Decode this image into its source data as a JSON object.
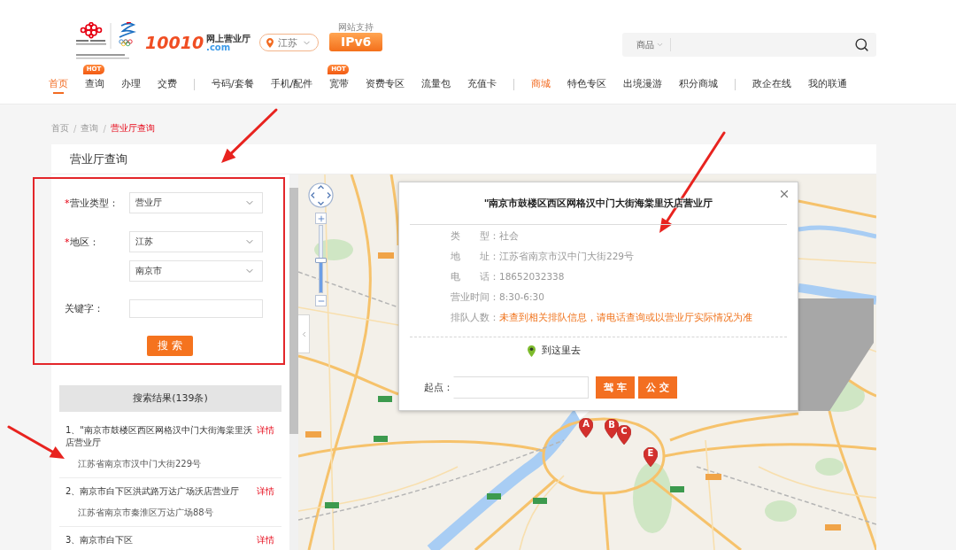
{
  "header": {
    "logo": {
      "number": "10010",
      "tagline": "网上营业厅",
      "domain": ".com"
    },
    "location": {
      "label": "江苏"
    },
    "ipv6": {
      "caption": "网站支持",
      "badge": "IPv6"
    },
    "search": {
      "category": "商品"
    }
  },
  "nav": [
    {
      "items": [
        {
          "label": "首页",
          "selected": true,
          "highlighted": false
        },
        {
          "label": "查询",
          "selected": false,
          "highlighted": false,
          "badge": "HOT"
        },
        {
          "label": "办理",
          "selected": false,
          "highlighted": false
        },
        {
          "label": "交费",
          "selected": false,
          "highlighted": false
        }
      ]
    },
    {
      "items": [
        {
          "label": "号码/套餐",
          "selected": false,
          "highlighted": false
        },
        {
          "label": "手机/配件",
          "selected": false,
          "highlighted": false
        },
        {
          "label": "宽带",
          "selected": false,
          "highlighted": false,
          "badge": "HOT"
        },
        {
          "label": "资费专区",
          "selected": false,
          "highlighted": false
        },
        {
          "label": "流量包",
          "selected": false,
          "highlighted": false
        },
        {
          "label": "充值卡",
          "selected": false,
          "highlighted": false
        }
      ]
    },
    {
      "items": [
        {
          "label": "商城",
          "selected": false,
          "highlighted": true
        },
        {
          "label": "特色专区",
          "selected": false,
          "highlighted": false
        },
        {
          "label": "出境漫游",
          "selected": false,
          "highlighted": false
        },
        {
          "label": "积分商城",
          "selected": false,
          "highlighted": false
        }
      ]
    },
    {
      "items": [
        {
          "label": "政企在线",
          "selected": false,
          "highlighted": false
        },
        {
          "label": "我的联通",
          "selected": false,
          "highlighted": false
        }
      ]
    }
  ],
  "breadcrumb": {
    "separator": "/",
    "items": [
      {
        "label": "首页",
        "current": false
      },
      {
        "label": "查询",
        "current": false
      },
      {
        "label": "营业厅查询",
        "current": true
      }
    ]
  },
  "panel": {
    "title": "营业厅查询"
  },
  "search_form": {
    "fields": [
      {
        "kind": "select",
        "required_mark": "*",
        "label": "营业类型：",
        "value": "营业厅"
      },
      {
        "kind": "select",
        "required_mark": "*",
        "label": "地区：",
        "value": "江苏"
      },
      {
        "kind": "select",
        "value": "南京市"
      },
      {
        "kind": "text",
        "label": "关键字："
      }
    ],
    "button": "搜 索"
  },
  "results": {
    "header": "搜索结果(139条)",
    "items": [
      {
        "title": "1、\"南京市鼓楼区西区网格汉中门大街海棠里沃店营业厅",
        "link": "详情",
        "address": "江苏省南京市汉中门大街229号"
      },
      {
        "title": "2、南京市白下区洪武路万达广场沃店营业厅",
        "link": "详情",
        "address": "江苏省南京市秦淮区万达广场88号"
      },
      {
        "title": "3、南京市白下区",
        "link": "详情"
      }
    ]
  },
  "map": {
    "zoom": {
      "level": 0.48
    },
    "markers": [
      {
        "label": "A"
      },
      {
        "label": "B"
      },
      {
        "label": "C"
      },
      {
        "label": "E"
      }
    ],
    "popup": {
      "title": "\"南京市鼓楼区西区网格汉中门大街海棠里沃店营业厅",
      "details": [
        {
          "kind": "plain",
          "label": "类　　型：",
          "value": "社会"
        },
        {
          "kind": "plain",
          "label": "地　　址：",
          "value": "江苏省南京市汉中门大街229号"
        },
        {
          "kind": "plain",
          "label": "电　　话：",
          "value": "18652032338"
        },
        {
          "kind": "plain",
          "label": "营业时间：",
          "value": "8:30-6:30"
        },
        {
          "kind": "notice",
          "label": "排队人数：",
          "value": "未查到相关排队信息，请电话查询或以营业厅实际情况为准"
        }
      ],
      "route_link": "到这里去",
      "start_label": "起点：",
      "buttons": [
        "驾 车",
        "公 交"
      ]
    }
  },
  "annotations": [
    {
      "kind": "arrow"
    },
    {
      "kind": "arrow"
    },
    {
      "kind": "box"
    },
    {
      "kind": "arrow"
    }
  ]
}
